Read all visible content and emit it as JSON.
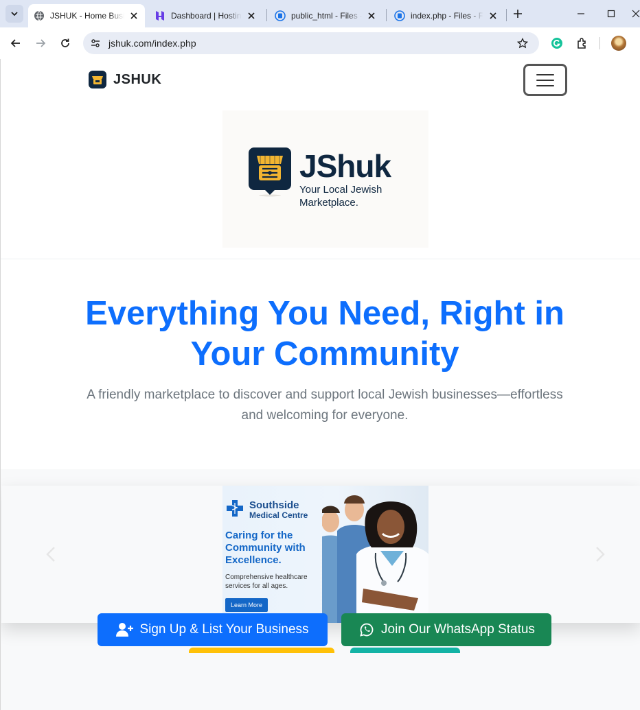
{
  "browser": {
    "tabs": [
      {
        "title": "JSHUK - Home Business",
        "favicon": "globe-icon",
        "active": true
      },
      {
        "title": "Dashboard | Hosting",
        "favicon": "hostinger-icon",
        "active": false
      },
      {
        "title": "public_html - Files -",
        "favicon": "file-manager-icon",
        "active": false
      },
      {
        "title": "index.php - Files - F",
        "favicon": "file-manager-icon",
        "active": false
      }
    ],
    "url": "jshuk.com/index.php"
  },
  "nav": {
    "brand": "JSHUK"
  },
  "logo": {
    "name": "JShuk",
    "tagline": "Your Local Jewish Marketplace."
  },
  "hero": {
    "title": "Everything You Need, Right in Your Community",
    "subtitle": "A friendly marketplace to discover and support local Jewish businesses—effortless and welcoming for everyone."
  },
  "ad": {
    "brand_line1": "Southside",
    "brand_line2": "Medical Centre",
    "headline": "Caring for the Community with Excellence.",
    "body": "Comprehensive healthcare services for all ages.",
    "button": "Learn More"
  },
  "cta": {
    "signup": "Sign Up & List Your Business",
    "whatsapp": "Join Our WhatsApp Status"
  },
  "colors": {
    "primary": "#0d6efd",
    "success": "#198754",
    "brand_navy": "#0f2740",
    "brand_gold": "#f2b531"
  }
}
